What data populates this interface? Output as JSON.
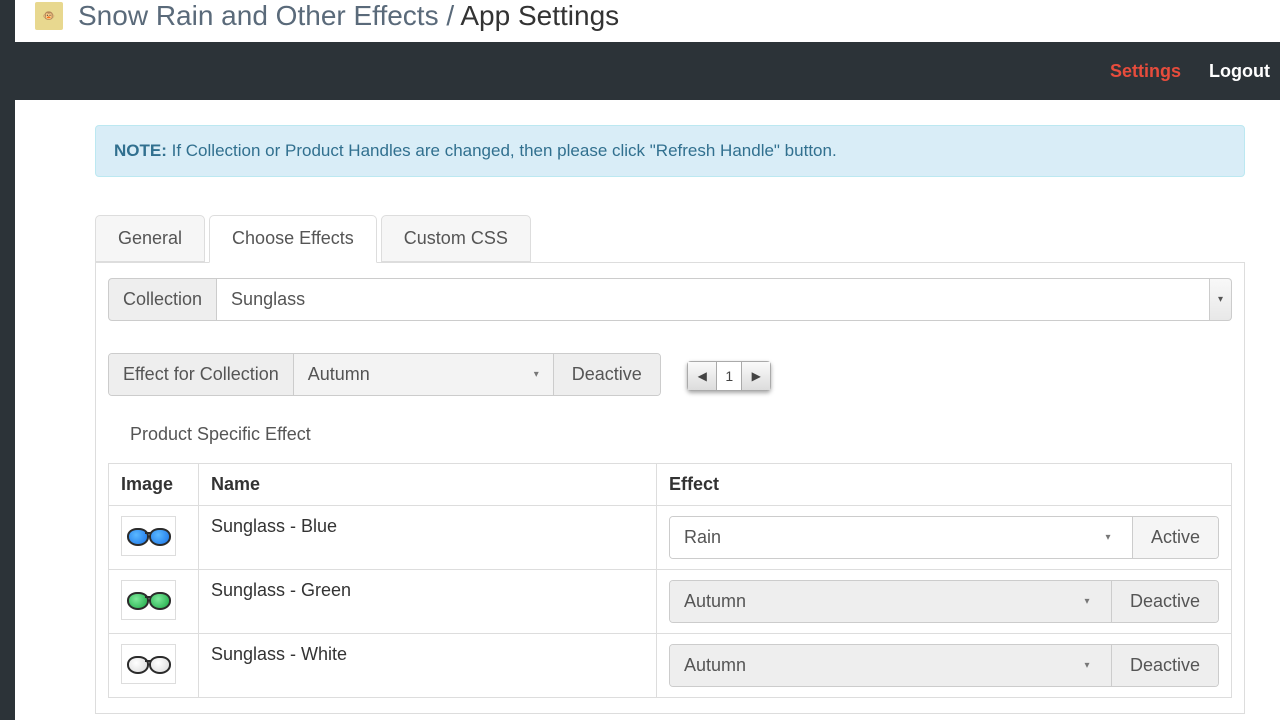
{
  "header": {
    "breadcrumb_app": "Snow Rain and Other Effects",
    "breadcrumb_sep": " / ",
    "breadcrumb_page": "App Settings"
  },
  "nav": {
    "settings": "Settings",
    "logout": "Logout"
  },
  "note": {
    "label": "NOTE:",
    "text": " If Collection or Product Handles are changed, then please click \"Refresh Handle\" button."
  },
  "tabs": {
    "general": "General",
    "choose_effects": "Choose Effects",
    "custom_css": "Custom CSS"
  },
  "collection": {
    "label": "Collection",
    "selected": "Sunglass"
  },
  "effect_collection": {
    "label": "Effect for Collection",
    "selected": "Autumn",
    "button": "Deactive"
  },
  "pager": {
    "prev": "◀",
    "page": "1",
    "next": "▶"
  },
  "section_title": "Product Specific Effect",
  "table": {
    "headers": {
      "image": "Image",
      "name": "Name",
      "effect": "Effect"
    },
    "rows": [
      {
        "name": "Sunglass - Blue",
        "effect": "Rain",
        "button": "Active",
        "color": "blue",
        "state": "active"
      },
      {
        "name": "Sunglass - Green",
        "effect": "Autumn",
        "button": "Deactive",
        "color": "green",
        "state": "inactive"
      },
      {
        "name": "Sunglass - White",
        "effect": "Autumn",
        "button": "Deactive",
        "color": "white",
        "state": "inactive"
      }
    ]
  }
}
